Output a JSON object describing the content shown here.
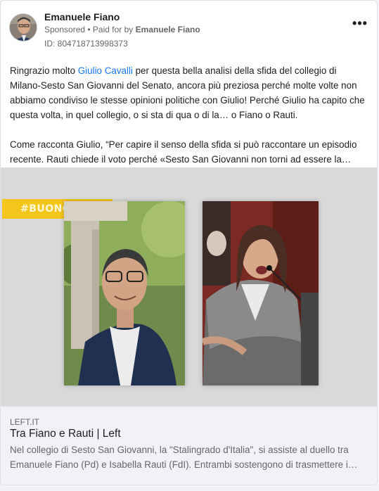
{
  "advertiser": {
    "name": "Emanuele Fiano",
    "sponsored": "Sponsored",
    "paid_for_prefix": "• Paid for by",
    "payer": "Emanuele Fiano",
    "ad_id": "ID: 804718713998373"
  },
  "post": {
    "p1_before": "Ringrazio molto ",
    "p1_link": "Giulio Cavalli",
    "p1_after": " per questa bella analisi della sfida del collegio di Milano-Sesto San Giovanni del Senato, ancora più preziosa perché molte volte non abbiamo condiviso le stesse opinioni politiche con Giulio! Perché Giulio ha capito che questa volta, in quel collegio, o si sta di qua o di la… o Fiano o Rauti.",
    "p2": "Come racconta Giulio, “Per capire il senso della sfida si può raccontare un episodio recente. Rauti chiede il voto perché «Sesto San Giovanni non torni ad essere la…"
  },
  "image": {
    "banner": "#BUONGIORNO"
  },
  "link_preview": {
    "domain": "LEFT.IT",
    "title": "Tra Fiano e Rauti | Left",
    "description": "Nel collegio di Sesto San Giovanni, la \"Stalingrado d'Italia\", si assiste al duello tra Emanuele Fiano (Pd) e Isabella Rauti (FdI). Entrambi sostengono di trasmettere i…"
  },
  "icons": {
    "more": "more-options-icon"
  },
  "colors": {
    "link": "#1877f2",
    "banner": "#f4c51b"
  }
}
